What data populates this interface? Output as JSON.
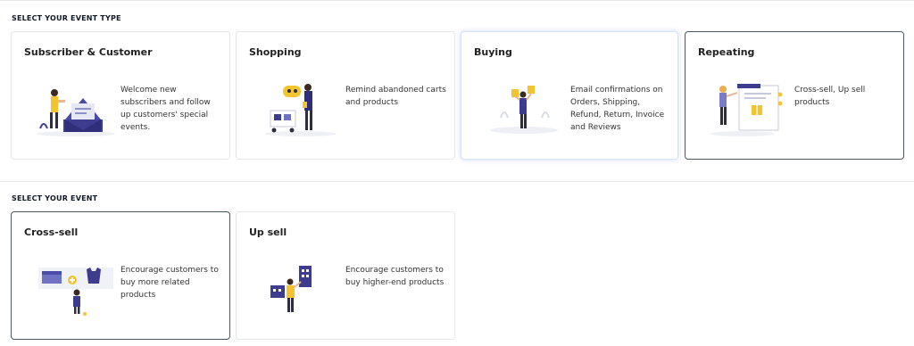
{
  "sections": {
    "event_type_label": "SELECT YOUR EVENT TYPE",
    "event_label": "SELECT YOUR EVENT"
  },
  "event_types": [
    {
      "title": "Subscriber & Customer",
      "description": "Welcome new subscribers and follow up customers' special events.",
      "icon": "email-envelope-illustration"
    },
    {
      "title": "Shopping",
      "description": "Remind abandoned carts and products",
      "icon": "shopping-cart-illustration"
    },
    {
      "title": "Buying",
      "description": "Email confirmations on Orders, Shipping, Refund, Return, Invoice and Reviews",
      "icon": "shopping-bags-illustration"
    },
    {
      "title": "Repeating",
      "description": "Cross-sell, Up sell products",
      "icon": "gift-board-illustration"
    }
  ],
  "events": [
    {
      "title": "Cross-sell",
      "description": "Encourage customers to buy more related products",
      "icon": "clothing-items-illustration"
    },
    {
      "title": "Up sell",
      "description": "Encourage customers to buy higher-end products",
      "icon": "products-tower-illustration"
    }
  ],
  "colors": {
    "accent_navy": "#3d3c8f",
    "accent_yellow": "#f4c430",
    "selected_border": "#4b5563",
    "hover_border": "#d7e3fb"
  }
}
